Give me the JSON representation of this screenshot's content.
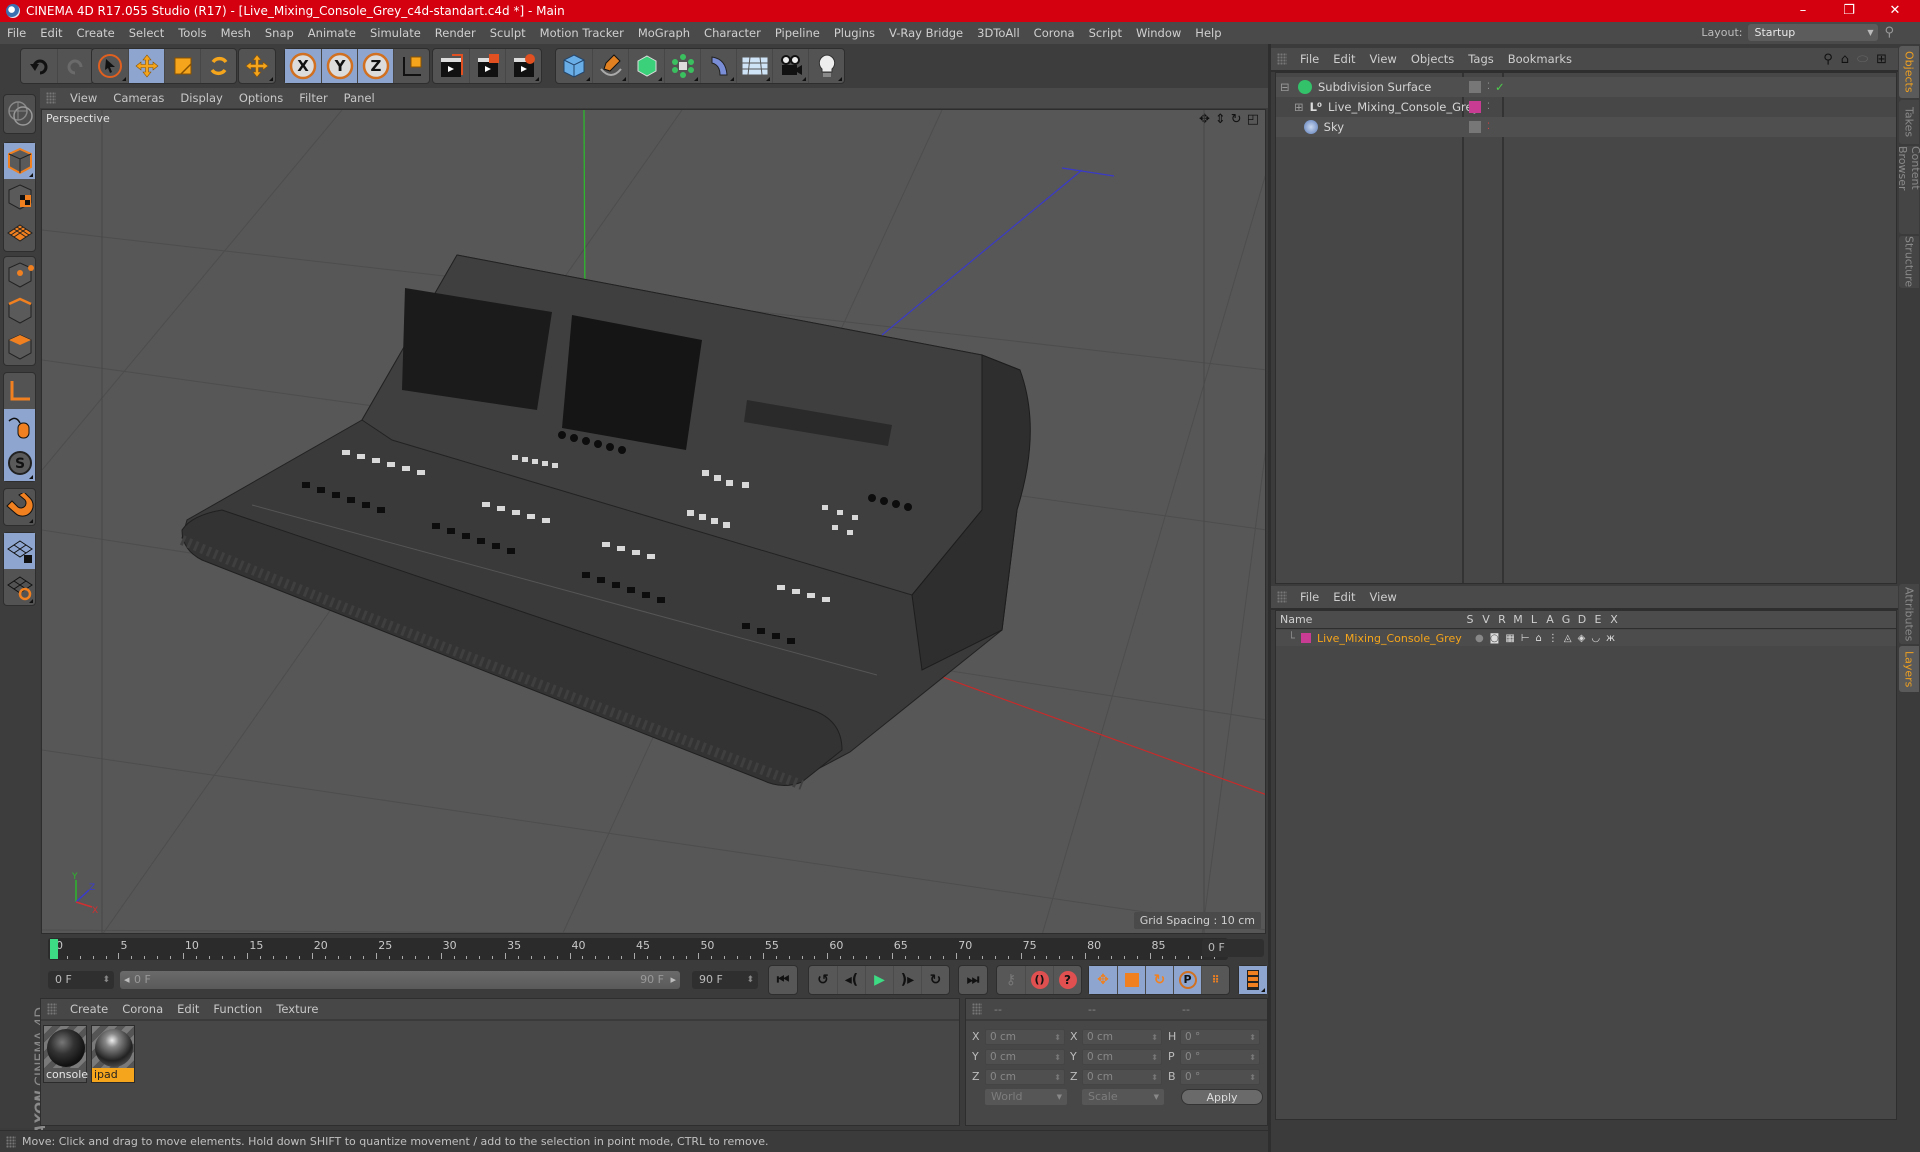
{
  "titlebar": {
    "title": "CINEMA 4D R17.055 Studio (R17) - [Live_Mixing_Console_Grey_c4d-standart.c4d *] - Main",
    "minimize": "–",
    "restore": "❐",
    "close": "✕"
  },
  "menubar": {
    "items": [
      "File",
      "Edit",
      "Create",
      "Select",
      "Tools",
      "Mesh",
      "Snap",
      "Animate",
      "Simulate",
      "Render",
      "Sculpt",
      "Motion Tracker",
      "MoGraph",
      "Character",
      "Pipeline",
      "Plugins",
      "V-Ray Bridge",
      "3DToAll",
      "Corona",
      "Script",
      "Window",
      "Help"
    ],
    "layout_label": "Layout:",
    "layout_value": "Startup"
  },
  "toolbar": {
    "tools": [
      "undo",
      "redo",
      "live-selection",
      "move",
      "scale",
      "rotate",
      "last-tool",
      "x-axis-lock",
      "y-axis-lock",
      "z-axis-lock",
      "coordinate-system",
      "render-view",
      "render-to-picture-viewer",
      "edit-render-settings",
      "cube",
      "pen-spline",
      "subdivision-surface",
      "cloner",
      "deformer",
      "floor",
      "camera",
      "light"
    ],
    "axis_x": "X",
    "axis_y": "Y",
    "axis_z": "Z"
  },
  "left_toolbar": {
    "tools": [
      "make-editable",
      "model-mode",
      "texture-mode",
      "workplane-mode",
      "point-mode",
      "edge-mode",
      "polygon-mode",
      "axis-mode",
      "tweak-mode",
      "snap",
      "magnet",
      "workplane-lock",
      "workplane-rotate"
    ]
  },
  "viewport": {
    "menu": [
      "View",
      "Cameras",
      "Display",
      "Options",
      "Filter",
      "Panel"
    ],
    "camera_label": "Perspective",
    "grid_spacing": "Grid Spacing : 10 cm",
    "axis_labels": {
      "x": "X",
      "y": "Y",
      "z": "Z"
    }
  },
  "object_manager": {
    "menu": [
      "File",
      "Edit",
      "View",
      "Objects",
      "Tags",
      "Bookmarks"
    ],
    "objects": [
      {
        "name": "Subdivision Surface",
        "icon": "subdivision-surface-icon",
        "check": "✓",
        "layer_color": ""
      },
      {
        "name": "Live_Mixing_Console_Grey",
        "icon": "null-object-icon",
        "check": "",
        "layer_color": "#c83c94"
      },
      {
        "name": "Sky",
        "icon": "sky-icon",
        "check": "",
        "layer_color": ""
      }
    ]
  },
  "layer_manager": {
    "menu": [
      "File",
      "Edit",
      "View"
    ],
    "columns": [
      "Name",
      "S",
      "V",
      "R",
      "M",
      "L",
      "A",
      "G",
      "D",
      "E",
      "X"
    ],
    "layers": [
      {
        "name": "Live_Mixing_Console_Grey",
        "color": "#c83c94"
      }
    ]
  },
  "right_tabs": {
    "top": [
      {
        "label": "Objects",
        "active": true
      },
      {
        "label": "Takes",
        "active": false
      },
      {
        "label": "Content Browser",
        "active": false
      },
      {
        "label": "Structure",
        "active": false
      }
    ],
    "bottom": [
      {
        "label": "Attributes",
        "active": false
      },
      {
        "label": "Layers",
        "active": true
      }
    ]
  },
  "timeline": {
    "ticks": [
      "0",
      "5",
      "10",
      "15",
      "20",
      "25",
      "30",
      "35",
      "40",
      "45",
      "50",
      "55",
      "60",
      "65",
      "70",
      "75",
      "80",
      "85",
      "90"
    ],
    "current_frame": "0 F",
    "start_field": "0 F",
    "range_start": "0 F",
    "range_end": "90 F",
    "end_field": "90 F",
    "current_frame_position": 0
  },
  "materials": {
    "menu": [
      "Create",
      "Corona",
      "Edit",
      "Function",
      "Texture"
    ],
    "items": [
      {
        "name": "console",
        "selected": false
      },
      {
        "name": "ipad",
        "selected": true
      }
    ]
  },
  "coordinates": {
    "headers": [
      "--",
      "--",
      "--"
    ],
    "rows": [
      {
        "l1": "X",
        "v1": "0 cm",
        "l2": "X",
        "v2": "0 cm",
        "l3": "H",
        "v3": "0 °"
      },
      {
        "l1": "Y",
        "v1": "0 cm",
        "l2": "Y",
        "v2": "0 cm",
        "l3": "P",
        "v3": "0 °"
      },
      {
        "l1": "Z",
        "v1": "0 cm",
        "l2": "Z",
        "v2": "0 cm",
        "l3": "B",
        "v3": "0 °"
      }
    ],
    "space_dropdown": "World",
    "mode_dropdown": "Scale",
    "apply_label": "Apply"
  },
  "branding": {
    "maxon": "MAXON",
    "product": "CINEMA 4D"
  },
  "status": {
    "text": "Move: Click and drag to move elements. Hold down SHIFT to quantize movement / add to the selection in point mode, CTRL to remove."
  },
  "colors": {
    "title_bar": "#d4000f",
    "accent_orange": "#f5a51b",
    "active_button": "#8ea6cf",
    "layer_magenta": "#c83c94",
    "axis_x": "#d23030",
    "axis_y": "#2cb82c",
    "axis_z": "#3a3ad0"
  }
}
